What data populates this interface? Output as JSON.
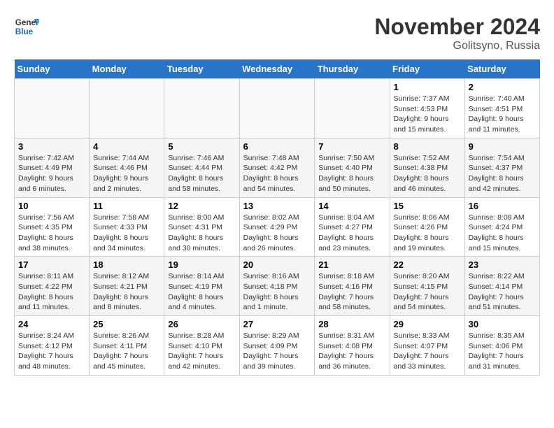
{
  "header": {
    "logo_line1": "General",
    "logo_line2": "Blue",
    "month": "November 2024",
    "location": "Golitsyno, Russia"
  },
  "days_of_week": [
    "Sunday",
    "Monday",
    "Tuesday",
    "Wednesday",
    "Thursday",
    "Friday",
    "Saturday"
  ],
  "weeks": [
    [
      {
        "day": "",
        "detail": ""
      },
      {
        "day": "",
        "detail": ""
      },
      {
        "day": "",
        "detail": ""
      },
      {
        "day": "",
        "detail": ""
      },
      {
        "day": "",
        "detail": ""
      },
      {
        "day": "1",
        "detail": "Sunrise: 7:37 AM\nSunset: 4:53 PM\nDaylight: 9 hours and 15 minutes."
      },
      {
        "day": "2",
        "detail": "Sunrise: 7:40 AM\nSunset: 4:51 PM\nDaylight: 9 hours and 11 minutes."
      }
    ],
    [
      {
        "day": "3",
        "detail": "Sunrise: 7:42 AM\nSunset: 4:49 PM\nDaylight: 9 hours and 6 minutes."
      },
      {
        "day": "4",
        "detail": "Sunrise: 7:44 AM\nSunset: 4:46 PM\nDaylight: 9 hours and 2 minutes."
      },
      {
        "day": "5",
        "detail": "Sunrise: 7:46 AM\nSunset: 4:44 PM\nDaylight: 8 hours and 58 minutes."
      },
      {
        "day": "6",
        "detail": "Sunrise: 7:48 AM\nSunset: 4:42 PM\nDaylight: 8 hours and 54 minutes."
      },
      {
        "day": "7",
        "detail": "Sunrise: 7:50 AM\nSunset: 4:40 PM\nDaylight: 8 hours and 50 minutes."
      },
      {
        "day": "8",
        "detail": "Sunrise: 7:52 AM\nSunset: 4:38 PM\nDaylight: 8 hours and 46 minutes."
      },
      {
        "day": "9",
        "detail": "Sunrise: 7:54 AM\nSunset: 4:37 PM\nDaylight: 8 hours and 42 minutes."
      }
    ],
    [
      {
        "day": "10",
        "detail": "Sunrise: 7:56 AM\nSunset: 4:35 PM\nDaylight: 8 hours and 38 minutes."
      },
      {
        "day": "11",
        "detail": "Sunrise: 7:58 AM\nSunset: 4:33 PM\nDaylight: 8 hours and 34 minutes."
      },
      {
        "day": "12",
        "detail": "Sunrise: 8:00 AM\nSunset: 4:31 PM\nDaylight: 8 hours and 30 minutes."
      },
      {
        "day": "13",
        "detail": "Sunrise: 8:02 AM\nSunset: 4:29 PM\nDaylight: 8 hours and 26 minutes."
      },
      {
        "day": "14",
        "detail": "Sunrise: 8:04 AM\nSunset: 4:27 PM\nDaylight: 8 hours and 23 minutes."
      },
      {
        "day": "15",
        "detail": "Sunrise: 8:06 AM\nSunset: 4:26 PM\nDaylight: 8 hours and 19 minutes."
      },
      {
        "day": "16",
        "detail": "Sunrise: 8:08 AM\nSunset: 4:24 PM\nDaylight: 8 hours and 15 minutes."
      }
    ],
    [
      {
        "day": "17",
        "detail": "Sunrise: 8:11 AM\nSunset: 4:22 PM\nDaylight: 8 hours and 11 minutes."
      },
      {
        "day": "18",
        "detail": "Sunrise: 8:12 AM\nSunset: 4:21 PM\nDaylight: 8 hours and 8 minutes."
      },
      {
        "day": "19",
        "detail": "Sunrise: 8:14 AM\nSunset: 4:19 PM\nDaylight: 8 hours and 4 minutes."
      },
      {
        "day": "20",
        "detail": "Sunrise: 8:16 AM\nSunset: 4:18 PM\nDaylight: 8 hours and 1 minute."
      },
      {
        "day": "21",
        "detail": "Sunrise: 8:18 AM\nSunset: 4:16 PM\nDaylight: 7 hours and 58 minutes."
      },
      {
        "day": "22",
        "detail": "Sunrise: 8:20 AM\nSunset: 4:15 PM\nDaylight: 7 hours and 54 minutes."
      },
      {
        "day": "23",
        "detail": "Sunrise: 8:22 AM\nSunset: 4:14 PM\nDaylight: 7 hours and 51 minutes."
      }
    ],
    [
      {
        "day": "24",
        "detail": "Sunrise: 8:24 AM\nSunset: 4:12 PM\nDaylight: 7 hours and 48 minutes."
      },
      {
        "day": "25",
        "detail": "Sunrise: 8:26 AM\nSunset: 4:11 PM\nDaylight: 7 hours and 45 minutes."
      },
      {
        "day": "26",
        "detail": "Sunrise: 8:28 AM\nSunset: 4:10 PM\nDaylight: 7 hours and 42 minutes."
      },
      {
        "day": "27",
        "detail": "Sunrise: 8:29 AM\nSunset: 4:09 PM\nDaylight: 7 hours and 39 minutes."
      },
      {
        "day": "28",
        "detail": "Sunrise: 8:31 AM\nSunset: 4:08 PM\nDaylight: 7 hours and 36 minutes."
      },
      {
        "day": "29",
        "detail": "Sunrise: 8:33 AM\nSunset: 4:07 PM\nDaylight: 7 hours and 33 minutes."
      },
      {
        "day": "30",
        "detail": "Sunrise: 8:35 AM\nSunset: 4:06 PM\nDaylight: 7 hours and 31 minutes."
      }
    ]
  ]
}
